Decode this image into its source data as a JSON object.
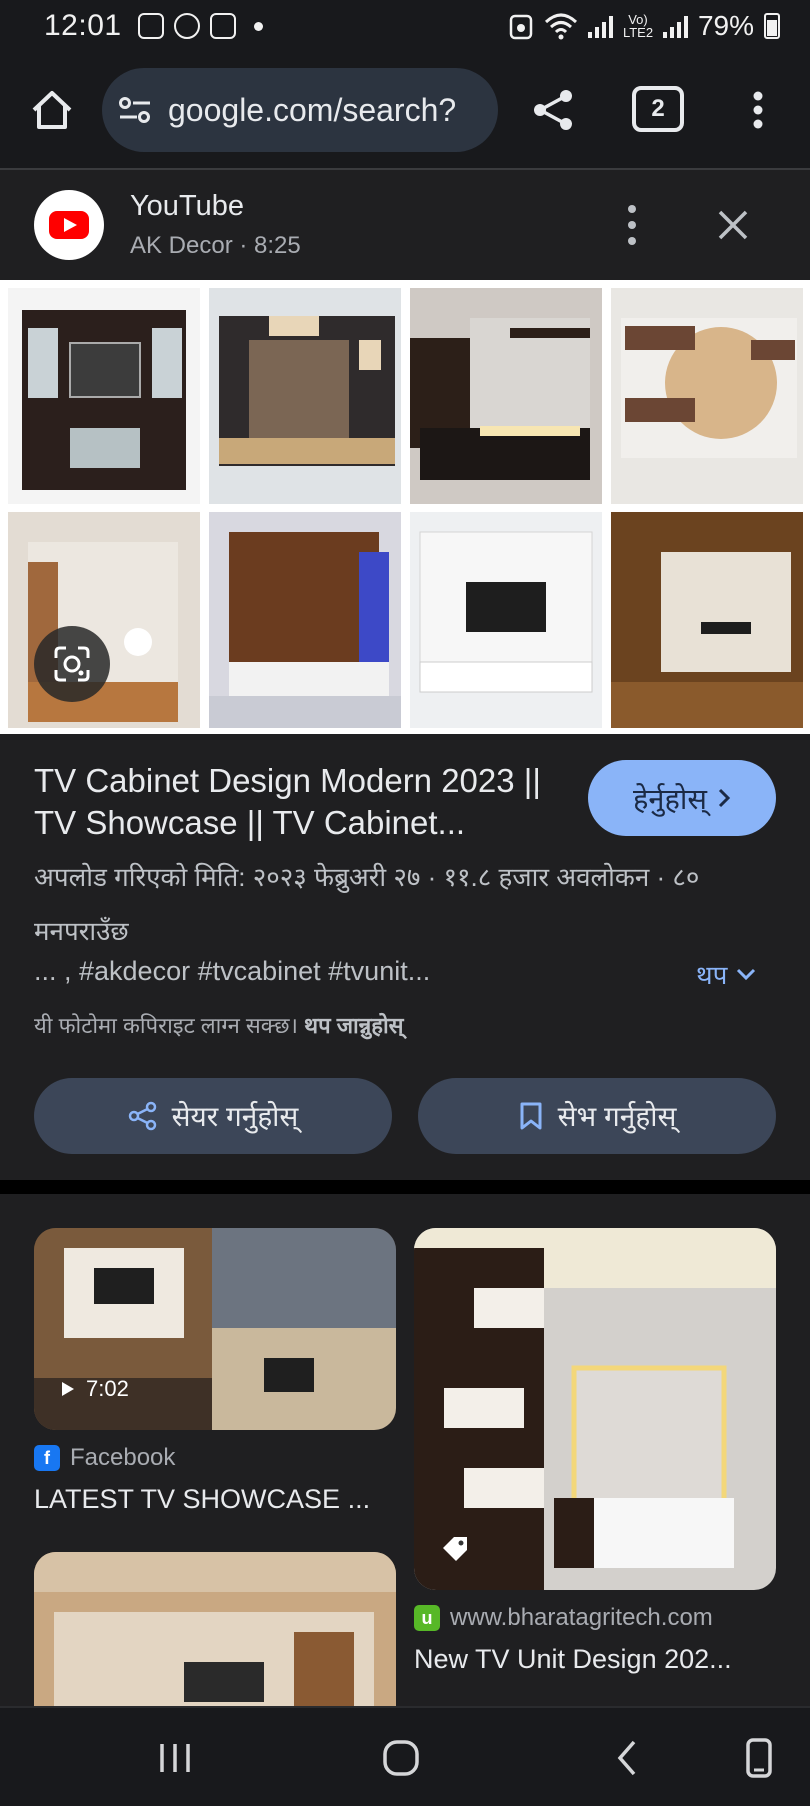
{
  "status_bar": {
    "time": "12:01",
    "battery": "79%",
    "network": "Vo) LTE2"
  },
  "toolbar": {
    "url": "google.com/search?",
    "tab_count": "2"
  },
  "source": {
    "name": "YouTube",
    "sub": "AK Decor · 8:25"
  },
  "result": {
    "title": "TV Cabinet Design Modern 2023 || TV Showcase || TV Cabinet...",
    "visit_label": "हेर्नुहोस्",
    "meta": "अपलोड गरिएको मिति: २०२३ फेब्रुअरी २७ · ११.८ हजार अवलोकन · ८० मनपराउँछ",
    "description": "... , #akdecor #tvcabinet #tvunit...",
    "more_label": "थप",
    "copyright_text": "यी फोटोमा कपिराइट लाग्न सक्छ।",
    "copyright_link": "थप जान्नुहोस्",
    "share_label": "सेयर गर्नुहोस्",
    "save_label": "सेभ गर्नुहोस्"
  },
  "related": [
    {
      "source": "Facebook",
      "title": "LATEST TV SHOWCASE ...",
      "duration": "7:02"
    },
    {
      "source": "www.bharatagritech.com",
      "title": "New TV Unit Design 202..."
    }
  ],
  "colors": {
    "accent": "#8ab4f8",
    "background": "#1f1f21",
    "youtube_red": "#ff0000",
    "facebook_blue": "#1877f2",
    "favicon_green": "#57b827"
  },
  "icons": [
    "home-icon",
    "site-settings-icon",
    "share-icon",
    "tabs-icon",
    "more-vert-icon",
    "close-icon",
    "lens-icon",
    "chevron-right-icon",
    "chevron-down-icon",
    "bookmark-icon",
    "play-icon",
    "tag-icon",
    "recents-icon",
    "home-nav-icon",
    "back-icon",
    "rotate-icon"
  ]
}
